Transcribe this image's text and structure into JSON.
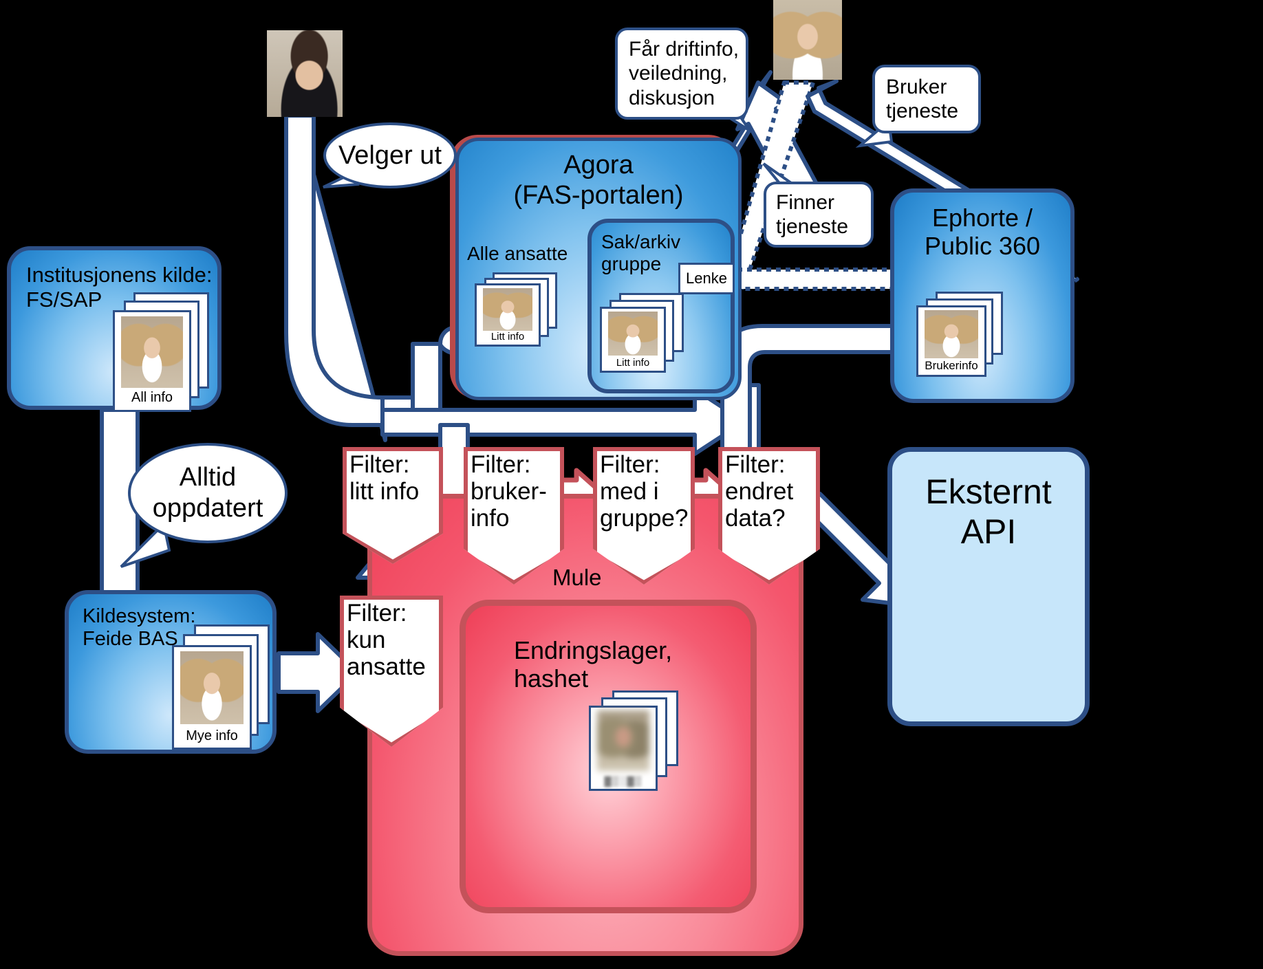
{
  "diagram": {
    "title_hidden": "",
    "boxes": {
      "institusjon": {
        "label": "Institusjonens kilde:\nFS/SAP",
        "card_label": "All info"
      },
      "kildesystem": {
        "label": "Kildesystem:\nFeide BAS",
        "card_label": "Mye info"
      },
      "agora": {
        "label": "Agora\n(FAS-portalen)"
      },
      "alle_ansatte": {
        "label": "Alle ansatte",
        "card_label": "Litt info"
      },
      "sak_arkiv": {
        "label": "Sak/arkiv\ngruppe",
        "card_label": "Litt info",
        "lenke_label": "Lenke"
      },
      "ephorte": {
        "label": "Ephorte /\nPublic 360",
        "card_label": "Brukerinfo"
      },
      "eksternt_api": {
        "label": "Eksternt\nAPI"
      },
      "mule": {
        "label": "Mule"
      },
      "endringslager": {
        "label": "Endringslager,\nhashet"
      }
    },
    "filters": [
      {
        "id": "filter-litt-info",
        "label": "Filter:\nlitt info"
      },
      {
        "id": "filter-brukerinfo",
        "label": "Filter:\nbruker-\ninfo"
      },
      {
        "id": "filter-med-i-gruppe",
        "label": "Filter:\nmed i\ngruppe?"
      },
      {
        "id": "filter-endret-data",
        "label": "Filter:\nendret\ndata?"
      },
      {
        "id": "filter-kun-ansatte",
        "label": "Filter:\nkun\nansatte"
      }
    ],
    "bubbles": [
      {
        "id": "bubble-velger-ut",
        "label": "Velger ut"
      },
      {
        "id": "bubble-alltid-oppdatert",
        "label": "Alltid\noppdatert"
      },
      {
        "id": "bubble-far-driftinfo",
        "label": "Får driftinfo,\nveiledning,\ndiskusjon"
      },
      {
        "id": "bubble-bruker-tjeneste",
        "label": "Bruker\ntjeneste"
      },
      {
        "id": "bubble-finner-tjeneste",
        "label": "Finner\ntjeneste"
      }
    ],
    "people": [
      {
        "id": "person-short-hair",
        "alt": "person-photo"
      },
      {
        "id": "person-blonde-top",
        "alt": "person-photo"
      }
    ],
    "colors": {
      "background": "#000000",
      "blue_border": "#2d4f86",
      "blue_fill": "#3c99dd",
      "light_blue_fill": "#c7e6fa",
      "red_border": "#c4525a",
      "red_fill": "#f4566d",
      "agora_red_outline": "#b94a4a",
      "arrow_fill": "#ffffff"
    }
  }
}
